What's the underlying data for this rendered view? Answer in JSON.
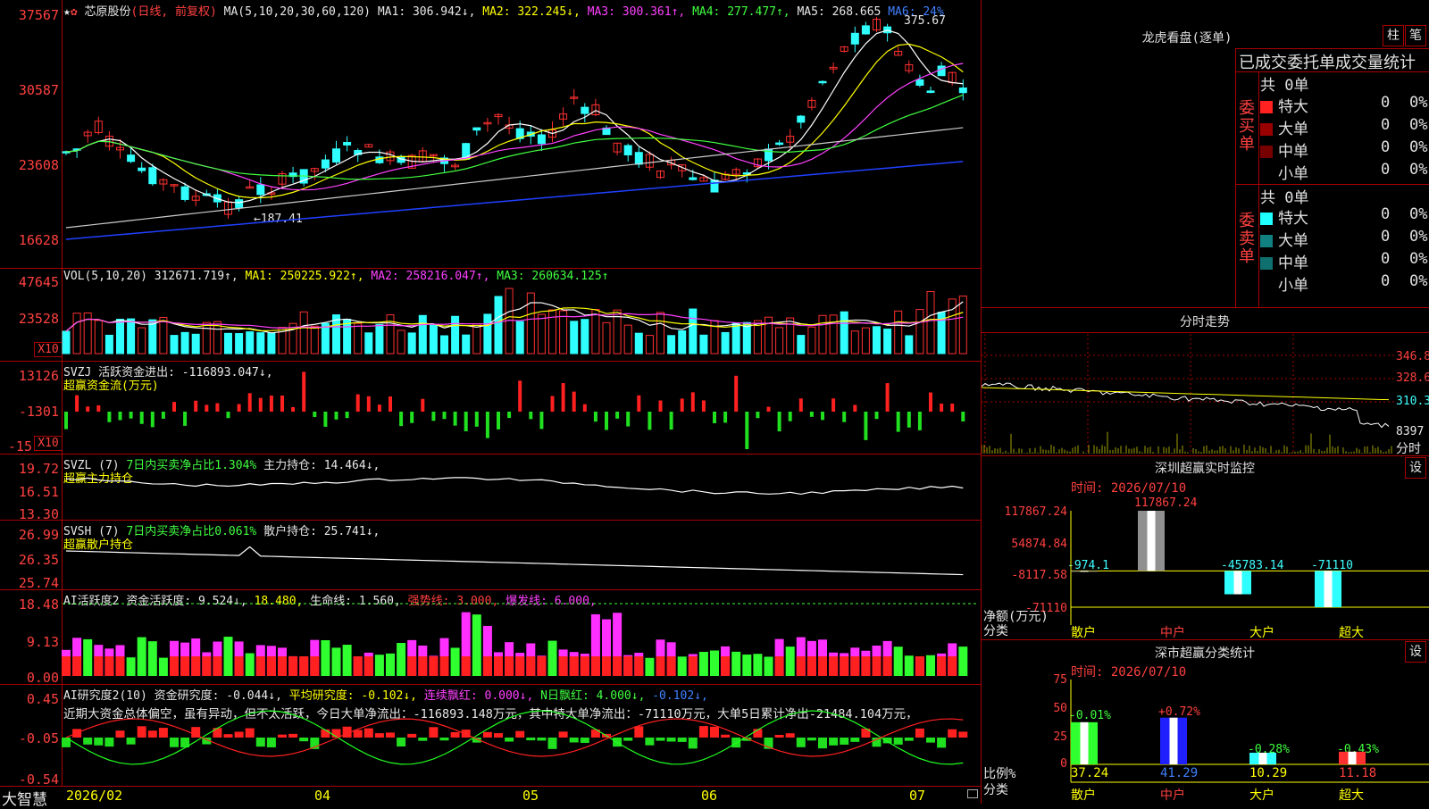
{
  "header": {
    "stock_name": "芯原股份",
    "period": "(日线, 前复权)",
    "ma_params": "MA(5,10,20,30,60,120)",
    "ma1": "MA1: 306.942↓,",
    "ma2": "MA2: 322.245↓,",
    "ma3": "MA3: 300.361↑,",
    "ma4": "MA4: 277.477↑,",
    "ma5": "MA5: 268.665",
    "ma6": "MA6: 24%"
  },
  "price_axis": [
    "37567",
    "30587",
    "23608",
    "16628"
  ],
  "price_annotations": {
    "high": "375.67",
    "low": "←187.41"
  },
  "vol": {
    "label": "VOL(5,10,20)",
    "value": "312671.719↑,",
    "ma1": "MA1: 250225.922↑,",
    "ma2": "MA2: 258216.047↑,",
    "ma3": "MA3: 260634.125↑",
    "axis": [
      "47645",
      "23528"
    ],
    "unit": "X10"
  },
  "svzj": {
    "label": "SVZJ",
    "value": "活跃资金进出: -116893.047↓,",
    "subtitle": "超赢资金流(万元)",
    "axis": [
      "13126",
      "-1301",
      "-15"
    ],
    "unit": "X10"
  },
  "svzl": {
    "label": "SVZL (7)",
    "ratio": "7日内买卖净占比1.304%",
    "hold": "主力持仓: 14.464↓,",
    "subtitle": "超赢主力持仓",
    "axis": [
      "19.72",
      "16.51",
      "13.30"
    ]
  },
  "svsh": {
    "label": "SVSH (7)",
    "ratio": "7日内买卖净占比0.061%",
    "hold": "散户持仓: 25.741↓,",
    "subtitle": "超赢散户持仓",
    "axis": [
      "26.99",
      "26.35",
      "25.74"
    ]
  },
  "ai_active": {
    "label": "AI活跃度2",
    "active": "资金活跃度: 9.524↓,",
    "v2": "18.480,",
    "life": "生命线: 1.560,",
    "strong": "强势线: 3.000,",
    "burst": "爆发线: 6.000,",
    "axis": [
      "18.48",
      "9.13",
      "0.00"
    ]
  },
  "ai_research": {
    "label": "AI研究度2(10)",
    "research": "资金研究度: -0.044↓,",
    "avg": "平均研究度: -0.102↓,",
    "cont": "连续飘红: 0.000↓,",
    "n": "N日飘红: 4.000↓,",
    "neg": "-0.102↓,",
    "summary": "近期大资金总体偏空，虽有异动，但不太活跃，今日大单净流出：-116893.148万元，其中特大单净流出：-71110万元，大单5日累计净出-21484.104万元，",
    "axis": [
      "0.45",
      "-0.05",
      "-0.54"
    ]
  },
  "date_axis": {
    "brand": "大智慧",
    "labels": [
      "2026/02",
      "04",
      "05",
      "06",
      "07"
    ]
  },
  "right": {
    "lhb_title": "龙虎看盘(逐单)",
    "btn_zhu": "柱",
    "btn_bi": "笔",
    "stat_title": "已成交委托单成交量统计",
    "buy": {
      "side": "委买单",
      "total": "共 0单",
      "rows": [
        {
          "name": "特大",
          "count": "0",
          "pct": "0%",
          "color": "#ff2020"
        },
        {
          "name": "大单",
          "count": "0",
          "pct": "0%",
          "color": "#990000"
        },
        {
          "name": "中单",
          "count": "0",
          "pct": "0%",
          "color": "#770000"
        },
        {
          "name": "小单",
          "count": "0",
          "pct": "0%",
          "color": ""
        }
      ]
    },
    "sell": {
      "side": "委卖单",
      "total": "共 0单",
      "rows": [
        {
          "name": "特大",
          "count": "0",
          "pct": "0%",
          "color": "#20ffff"
        },
        {
          "name": "大单",
          "count": "0",
          "pct": "0%",
          "color": "#108080"
        },
        {
          "name": "中单",
          "count": "0",
          "pct": "0%",
          "color": "#107070"
        },
        {
          "name": "小单",
          "count": "0",
          "pct": "0%",
          "color": ""
        }
      ]
    },
    "minute": {
      "title": "分时走势",
      "axis": [
        "346.8",
        "328.6",
        "310.3",
        "8397"
      ],
      "unit": "分时"
    },
    "sz_monitor": {
      "title": "深圳超赢实时监控",
      "btn": "设",
      "date": "时间: 2026/07/10",
      "axis": [
        "117867.24",
        "54874.84",
        "-8117.58",
        "-71110"
      ],
      "ylabel": "净额(万元)",
      "xlabel": "分类",
      "categories": [
        "散户",
        "中户",
        "大户",
        "超大"
      ],
      "values": [
        -974.1,
        117867.24,
        -45783.14,
        -71110
      ],
      "labels": [
        "-974.1",
        "117867.24",
        "-45783.14",
        "-71110"
      ]
    },
    "sz_class": {
      "title": "深市超赢分类统计",
      "btn": "设",
      "date": "时间: 2026/07/10",
      "axis": [
        "75",
        "50",
        "25",
        "0"
      ],
      "ylabel": "比例%",
      "xlabel": "分类",
      "categories": [
        "散户",
        "中户",
        "大户",
        "超大"
      ],
      "values": [
        37.24,
        41.29,
        10.29,
        11.18
      ],
      "changes": [
        "-0.01%",
        "+0.72%",
        "-0.28%",
        "-0.43%"
      ],
      "value_labels": [
        "37.24",
        "41.29",
        "10.29",
        "11.18"
      ]
    }
  }
}
